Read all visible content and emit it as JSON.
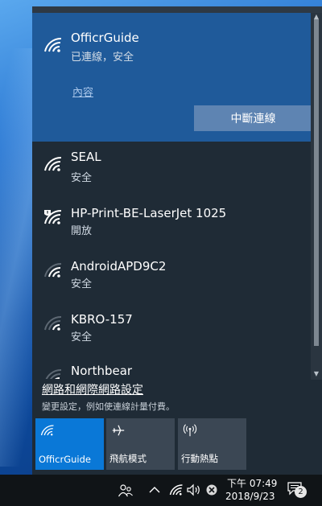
{
  "connected": {
    "ssid": "OfficrGuide",
    "status": "已連線，安全",
    "properties_label": "內容",
    "disconnect_label": "中斷連線"
  },
  "networks": [
    {
      "ssid": "SEAL",
      "status": "安全"
    },
    {
      "ssid": "HP-Print-BE-LaserJet 1025",
      "status": "開放"
    },
    {
      "ssid": "AndroidAPD9C2",
      "status": "安全"
    },
    {
      "ssid": "KBRO-157",
      "status": "安全"
    },
    {
      "ssid": "Northbear",
      "status": ""
    }
  ],
  "settings": {
    "title": "網路和網際網路設定",
    "description": "變更設定，例如使連線計量付費。"
  },
  "quick_actions": [
    {
      "label": "OfficrGuide",
      "icon": "wifi-icon",
      "active": true
    },
    {
      "label": "飛航模式",
      "icon": "airplane-icon",
      "active": false
    },
    {
      "label": "行動熱點",
      "icon": "hotspot-icon",
      "active": false
    }
  ],
  "taskbar": {
    "time": "下午 07:49",
    "date": "2018/9/23",
    "notification_count": "2"
  },
  "colors": {
    "accent": "#0a78d7",
    "panel_bg": "#1f2b36",
    "connected_bg": "#1f5a9a"
  }
}
